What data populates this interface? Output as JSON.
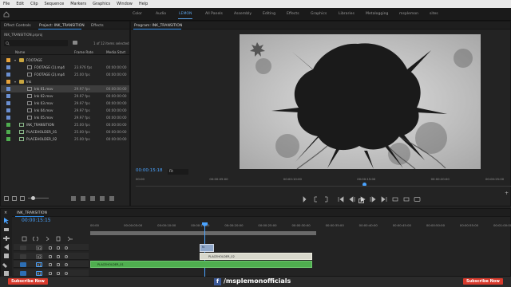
{
  "menubar": [
    "File",
    "Edit",
    "Clip",
    "Sequence",
    "Markers",
    "Graphics",
    "Window",
    "Help"
  ],
  "workspace": {
    "tabs": [
      "Color",
      "Audio",
      "LEMON",
      "All Panels",
      "Assembly",
      "Editing",
      "Effects",
      "Graphics",
      "Libraries",
      "Metalogging",
      "msplemon",
      "sites"
    ],
    "active": "LEMON"
  },
  "left_panel": {
    "tabs": [
      "Effect Controls",
      "Project: INK_TRANSITION",
      "Effects"
    ],
    "active_tab": "Project: INK_TRANSITION",
    "project_file": "INK_TRANSITION.prproj",
    "items_selected": "1 of 12 items selected",
    "columns": {
      "name": "Name",
      "frame_rate": "Frame Rate",
      "media_start": "Media Start"
    },
    "rows": [
      {
        "name": "FOOTAGE",
        "fps": "",
        "ms": "",
        "indent": 1,
        "type": "folder",
        "color": "#e8a33a"
      },
      {
        "name": "FOOTAGE (1).mp4",
        "fps": "23.976 fps",
        "ms": "00:00:00:00",
        "indent": 3,
        "type": "clip",
        "color": "#6a8fd1"
      },
      {
        "name": "FOOTAGE (2).mp4",
        "fps": "25.00 fps",
        "ms": "00:00:00:00",
        "indent": 3,
        "type": "clip",
        "color": "#6a8fd1"
      },
      {
        "name": "Ink",
        "fps": "",
        "ms": "",
        "indent": 1,
        "type": "folder",
        "color": "#e8a33a"
      },
      {
        "name": "Ink 01.mov",
        "fps": "29.97 fps",
        "ms": "00:00:00:00",
        "indent": 3,
        "type": "clip",
        "color": "#6a8fd1",
        "selected": true
      },
      {
        "name": "Ink 02.mov",
        "fps": "29.97 fps",
        "ms": "00:00:00:00",
        "indent": 3,
        "type": "clip",
        "color": "#6a8fd1"
      },
      {
        "name": "Ink 03.mov",
        "fps": "29.97 fps",
        "ms": "00:00:00:00",
        "indent": 3,
        "type": "clip",
        "color": "#6a8fd1"
      },
      {
        "name": "Ink 04.mov",
        "fps": "29.97 fps",
        "ms": "00:00:00:00",
        "indent": 3,
        "type": "clip",
        "color": "#6a8fd1"
      },
      {
        "name": "Ink 05.mov",
        "fps": "29.97 fps",
        "ms": "00:00:00:00",
        "indent": 3,
        "type": "clip",
        "color": "#6a8fd1"
      },
      {
        "name": "INK_TRANSITION",
        "fps": "25.00 fps",
        "ms": "00:00:00:00",
        "indent": 1,
        "type": "sequence",
        "color": "#4fae4f"
      },
      {
        "name": "PLACEHOLDER_01",
        "fps": "25.00 fps",
        "ms": "00:00:00:00",
        "indent": 1,
        "type": "sequence",
        "color": "#4fae4f"
      },
      {
        "name": "PLACEHOLDER_02",
        "fps": "25.00 fps",
        "ms": "00:00:00:00",
        "indent": 1,
        "type": "sequence",
        "color": "#4fae4f"
      }
    ]
  },
  "program_monitor": {
    "title": "Program: INK_TRANSITION",
    "timecode": "00:00:15:18",
    "fit": "Fit",
    "ruler": [
      "00:00",
      "00:00:05:00",
      "00:00:10:00",
      "00:00:15:00",
      "00:00:20:00",
      "00:00:25:00"
    ],
    "playhead_fraction": 0.62
  },
  "timeline": {
    "title": "INK_TRANSITION",
    "timecode": "00:00:15:15",
    "ruler": [
      "00:00",
      "00:00:05:00",
      "00:00:10:00",
      "00:00:15:00",
      "00:00:20:00",
      "00:00:25:00",
      "00:00:30:00",
      "00:00:35:00",
      "00:00:40:00",
      "00:00:45:00",
      "00:00:50:00",
      "00:00:55:00",
      "00:01:00:00"
    ],
    "tracks": [
      "V3",
      "V2",
      "V1",
      "A1"
    ],
    "clips": {
      "v3": "fx",
      "v2": "PLACEHOLDER_02",
      "v1": "PLACEHOLDER_01"
    }
  },
  "banner": {
    "subscribe_left": "Subscribe Now",
    "channel": "/msplemonofficials",
    "subscribe_right": "Subscribe Now"
  }
}
